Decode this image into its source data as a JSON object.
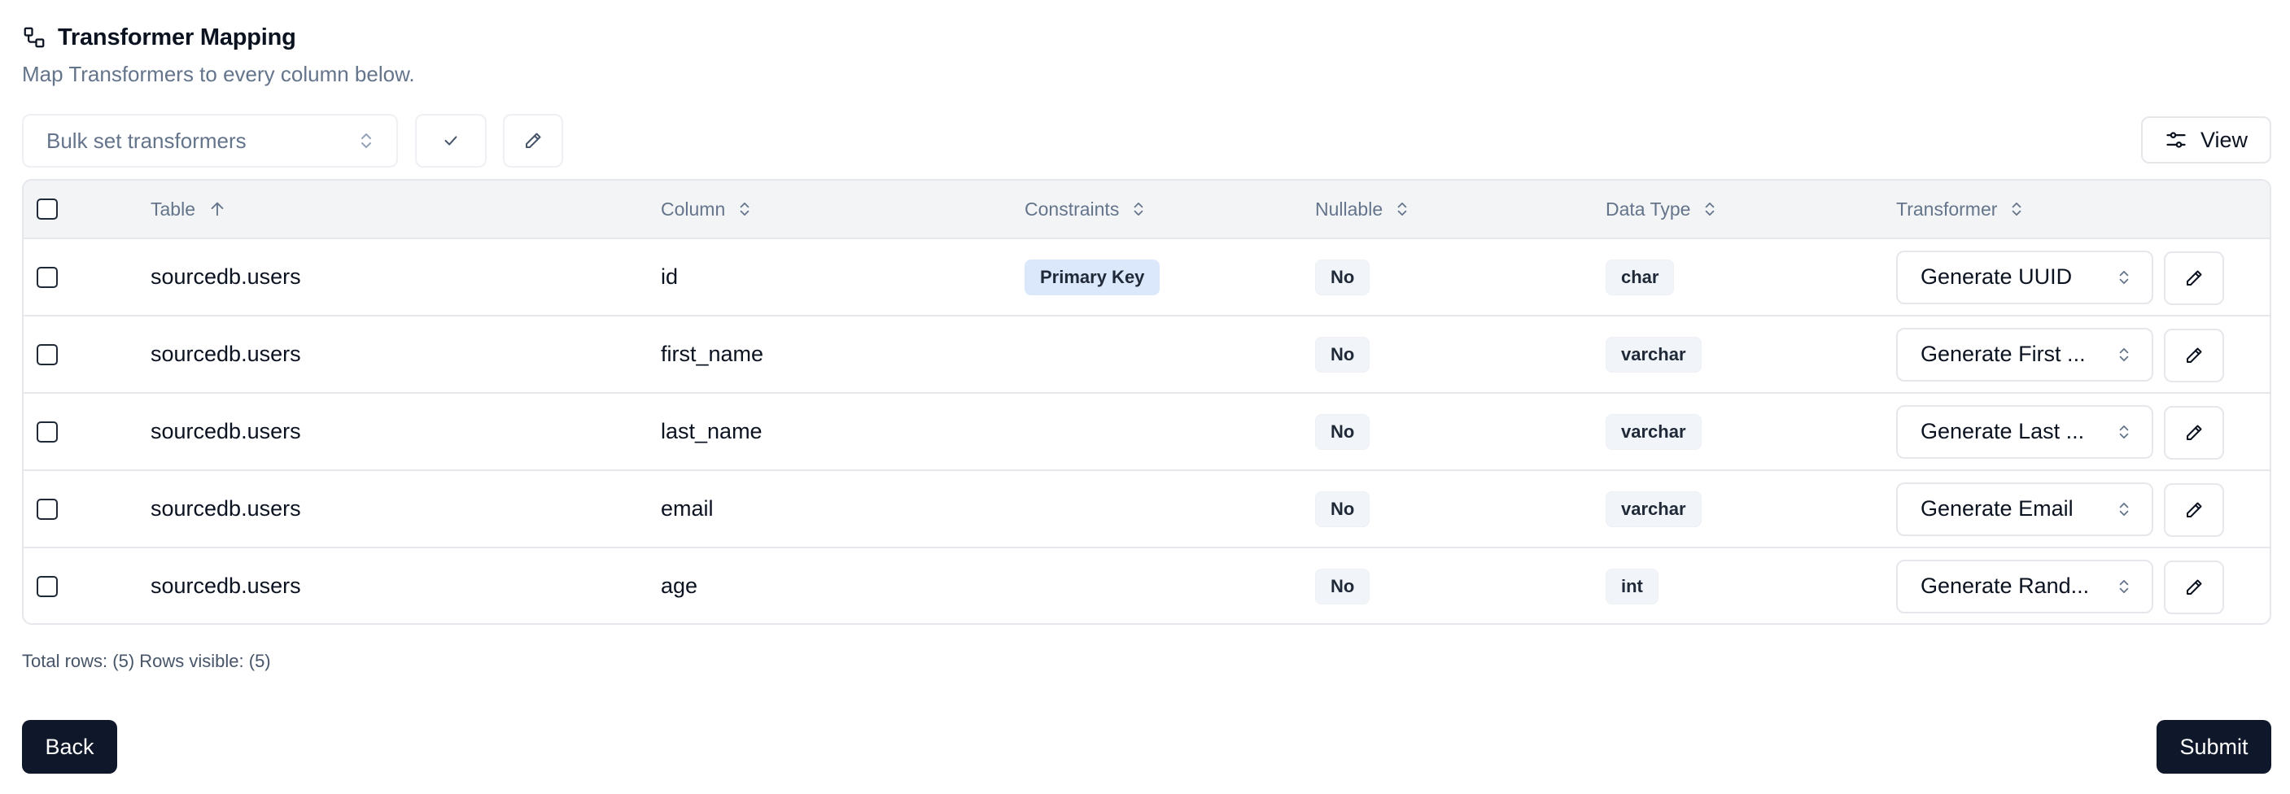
{
  "header": {
    "title": "Transformer Mapping",
    "subtitle": "Map Transformers to every column below.",
    "icon": "workflow-icon"
  },
  "toolbar": {
    "bulk_placeholder": "Bulk set transformers",
    "view_label": "View"
  },
  "table": {
    "columns": [
      "Table",
      "Column",
      "Constraints",
      "Nullable",
      "Data Type",
      "Transformer"
    ],
    "rows": [
      {
        "table": "sourcedb.users",
        "column": "id",
        "constraint": "Primary Key",
        "nullable": "No",
        "data_type": "char",
        "transformer": "Generate UUID"
      },
      {
        "table": "sourcedb.users",
        "column": "first_name",
        "constraint": "",
        "nullable": "No",
        "data_type": "varchar",
        "transformer": "Generate First ..."
      },
      {
        "table": "sourcedb.users",
        "column": "last_name",
        "constraint": "",
        "nullable": "No",
        "data_type": "varchar",
        "transformer": "Generate Last ..."
      },
      {
        "table": "sourcedb.users",
        "column": "email",
        "constraint": "",
        "nullable": "No",
        "data_type": "varchar",
        "transformer": "Generate Email"
      },
      {
        "table": "sourcedb.users",
        "column": "age",
        "constraint": "",
        "nullable": "No",
        "data_type": "int",
        "transformer": "Generate Rand..."
      }
    ]
  },
  "footer": {
    "rows_info": "Total rows: (5) Rows visible: (5)",
    "back_label": "Back",
    "submit_label": "Submit"
  },
  "colors": {
    "primary": "#0f172a",
    "pk_badge": "#dbe7fb",
    "header_bg": "#f3f4f6"
  }
}
